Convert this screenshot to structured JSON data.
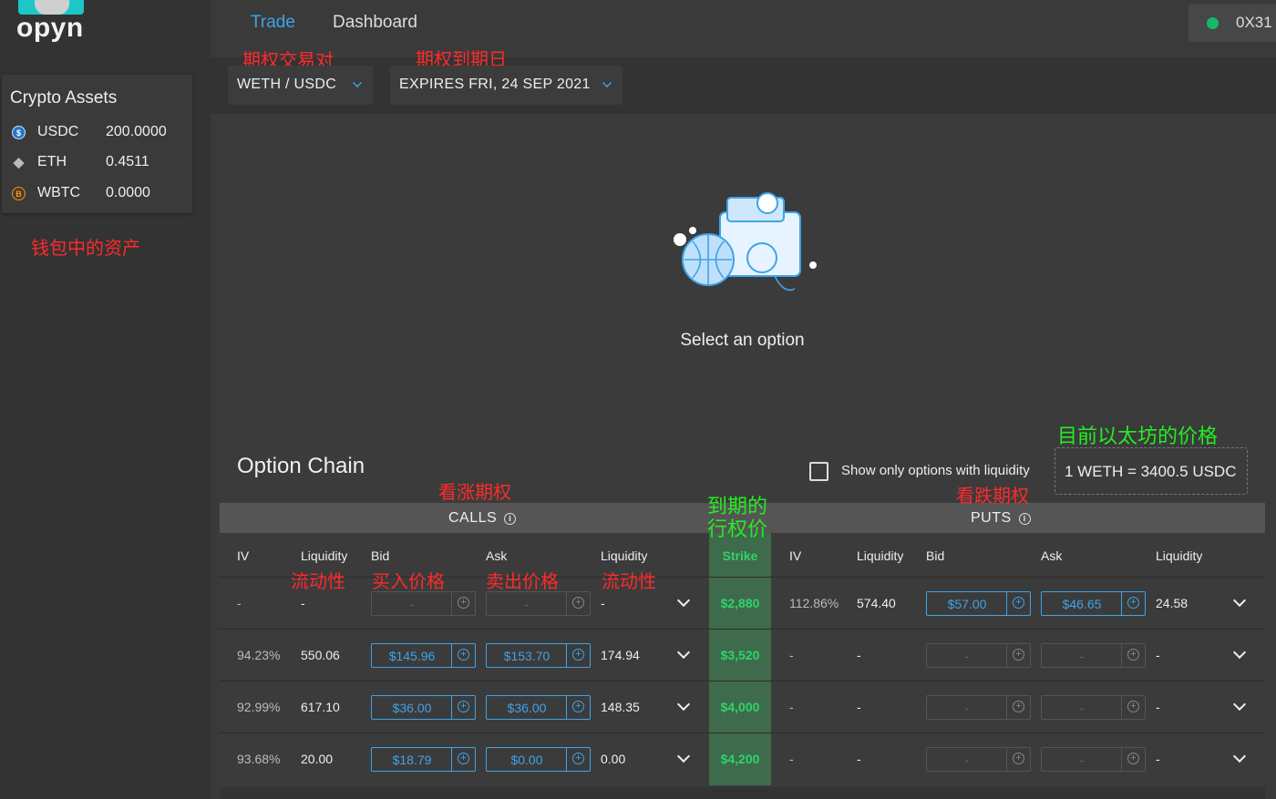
{
  "brand": {
    "name": "opyn"
  },
  "nav": {
    "trade": "Trade",
    "dashboard": "Dashboard"
  },
  "wallet": {
    "address": "0X31",
    "status_color": "#15b86a"
  },
  "assets": {
    "title": "Crypto Assets",
    "items": [
      {
        "symbol": "USDC",
        "amount": "200.0000",
        "icon": "usdc-icon",
        "glyph": "$"
      },
      {
        "symbol": "ETH",
        "amount": "0.4511",
        "icon": "eth-icon",
        "glyph": "◆"
      },
      {
        "symbol": "WBTC",
        "amount": "0.0000",
        "icon": "wbtc-icon",
        "glyph": "B"
      }
    ]
  },
  "selectors": {
    "pair": "WETH / USDC",
    "expiry": "EXPIRES FRI, 24 SEP 2021"
  },
  "panel": {
    "message": "Select an option"
  },
  "chain": {
    "title": "Option Chain",
    "liquidity_filter_label": "Show only options with liquidity",
    "price": "1 WETH = 3400.5 USDC",
    "calls_label": "CALLS",
    "puts_label": "PUTS",
    "headers": {
      "iv": "IV",
      "liquidity": "Liquidity",
      "bid": "Bid",
      "ask": "Ask",
      "strike": "Strike"
    },
    "rows": [
      {
        "call_iv": "-",
        "call_liq": "-",
        "call_bid": "-",
        "call_ask": "-",
        "call_liq2": "-",
        "strike": "$2,880",
        "put_iv": "112.86%",
        "put_liq": "574.40",
        "put_bid": "$57.00",
        "put_ask": "$46.65",
        "put_liq2": "24.58"
      },
      {
        "call_iv": "94.23%",
        "call_liq": "550.06",
        "call_bid": "$145.96",
        "call_ask": "$153.70",
        "call_liq2": "174.94",
        "strike": "$3,520",
        "put_iv": "-",
        "put_liq": "-",
        "put_bid": "-",
        "put_ask": "-",
        "put_liq2": "-"
      },
      {
        "call_iv": "92.99%",
        "call_liq": "617.10",
        "call_bid": "$36.00",
        "call_ask": "$36.00",
        "call_liq2": "148.35",
        "strike": "$4,000",
        "put_iv": "-",
        "put_liq": "-",
        "put_bid": "-",
        "put_ask": "-",
        "put_liq2": "-"
      },
      {
        "call_iv": "93.68%",
        "call_liq": "20.00",
        "call_bid": "$18.79",
        "call_ask": "$0.00",
        "call_liq2": "0.00",
        "strike": "$4,200",
        "put_iv": "-",
        "put_liq": "-",
        "put_bid": "-",
        "put_ask": "-",
        "put_liq2": "-"
      }
    ]
  },
  "annotations": {
    "pair": "期权交易对",
    "expiry": "期权到期日",
    "wallet_assets": "钱包中的资产",
    "calls": "看涨期权",
    "puts": "看跌期权",
    "strike": "到期的\n行权价",
    "eth_price": "目前以太坊的价格",
    "liquidity": "流动性",
    "bid": "买入价格",
    "ask": "卖出价格",
    "liquidity2": "流动性"
  },
  "colors": {
    "accent": "#3fa3e8",
    "strike_green": "#2fd36a",
    "annotation_red": "#ff2a2a",
    "annotation_green": "#22ee22"
  }
}
